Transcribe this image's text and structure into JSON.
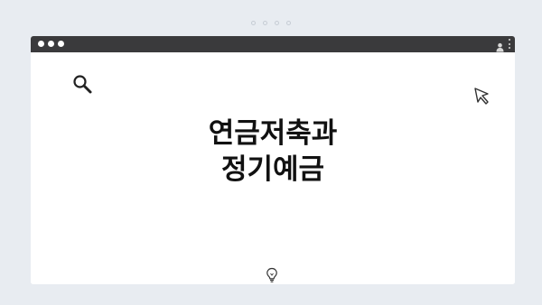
{
  "carousel": {
    "dot_count": 4,
    "dot_color": "#c6ccd4"
  },
  "window": {
    "titlebar_color": "#3a3a3c",
    "background_color": "#ffffff"
  },
  "icons": {
    "search": "search-icon",
    "cursor": "cursor-arrow-icon",
    "lightbulb": "lightbulb-icon",
    "user": "user-icon",
    "menu": "kebab-menu-icon"
  },
  "headline": {
    "line1": "연금저축과",
    "line2": "정기예금"
  }
}
